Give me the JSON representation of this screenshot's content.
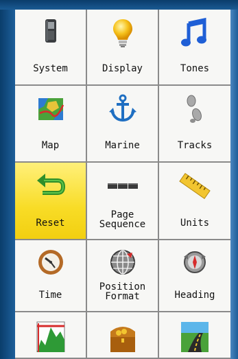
{
  "menu": {
    "items": [
      {
        "label": "System",
        "icon": "gps-device-icon"
      },
      {
        "label": "Display",
        "icon": "lightbulb-icon"
      },
      {
        "label": "Tones",
        "icon": "music-note-icon"
      },
      {
        "label": "Map",
        "icon": "map-icon"
      },
      {
        "label": "Marine",
        "icon": "anchor-icon"
      },
      {
        "label": "Tracks",
        "icon": "footprints-icon"
      },
      {
        "label": "Reset",
        "icon": "reset-arrow-icon",
        "selected": true
      },
      {
        "label": "Page\nSequence",
        "icon": "page-sequence-icon"
      },
      {
        "label": "Units",
        "icon": "ruler-icon"
      },
      {
        "label": "Time",
        "icon": "clock-icon"
      },
      {
        "label": "Position\nFormat",
        "icon": "globe-grid-icon"
      },
      {
        "label": "Heading",
        "icon": "compass-icon"
      },
      {
        "label": "",
        "icon": "elevation-chart-icon"
      },
      {
        "label": "",
        "icon": "treasure-chest-icon"
      },
      {
        "label": "",
        "icon": "road-icon"
      }
    ]
  },
  "colors": {
    "selected_tile": "#f8dc26",
    "bezel_blue": "#1a5a93",
    "tile_background": "#f7f7f5"
  }
}
